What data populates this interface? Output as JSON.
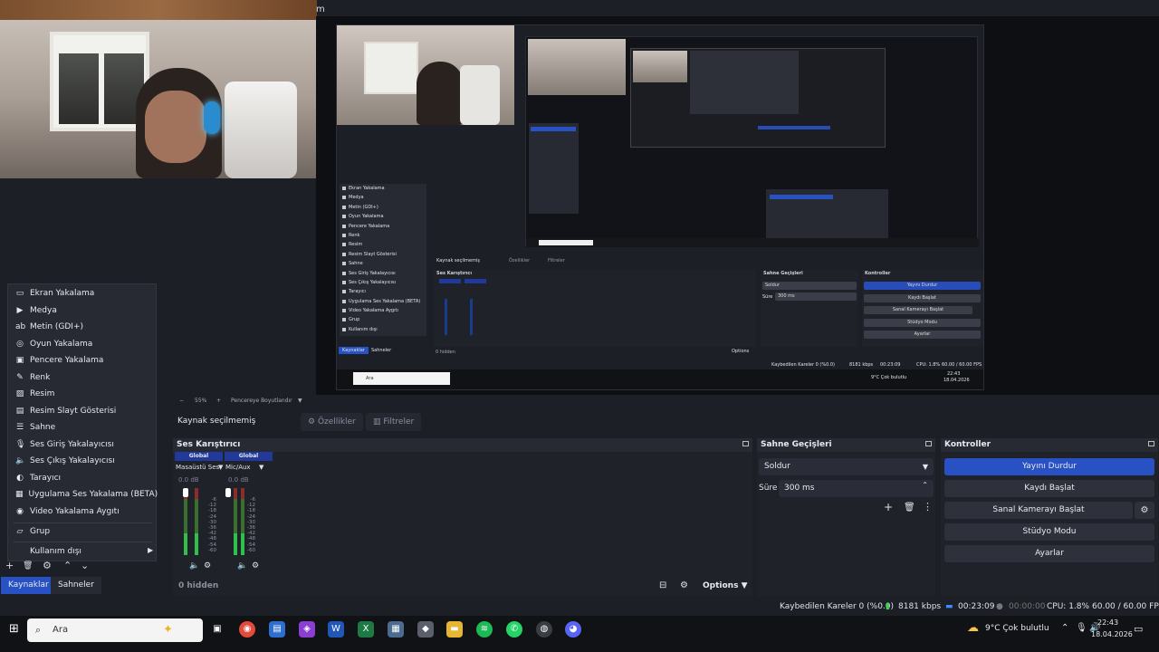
{
  "window": {
    "title_fragment": "m"
  },
  "context_menu": {
    "items": [
      {
        "label": "Ekran Yakalama",
        "icon": "monitor-icon"
      },
      {
        "label": "Medya",
        "icon": "play-icon"
      },
      {
        "label": "Metin (GDI+)",
        "icon": "text-icon"
      },
      {
        "label": "Oyun Yakalama",
        "icon": "gamepad-icon"
      },
      {
        "label": "Pencere Yakalama",
        "icon": "window-icon"
      },
      {
        "label": "Renk",
        "icon": "brush-icon"
      },
      {
        "label": "Resim",
        "icon": "image-icon"
      },
      {
        "label": "Resim Slayt Gösterisi",
        "icon": "slideshow-icon"
      },
      {
        "label": "Sahne",
        "icon": "list-icon"
      },
      {
        "label": "Ses Giriş Yakalayıcısı",
        "icon": "microphone-icon"
      },
      {
        "label": "Ses Çıkış Yakalayıcısı",
        "icon": "speaker-icon"
      },
      {
        "label": "Tarayıcı",
        "icon": "globe-icon"
      },
      {
        "label": "Uygulama Ses Yakalama (BETA)",
        "icon": "app-audio-icon"
      },
      {
        "label": "Video Yakalama Aygıtı",
        "icon": "camera-icon"
      },
      {
        "label": "Grup",
        "icon": "folder-icon"
      },
      {
        "label": "Kullanım dışı",
        "icon": "chevron-right-icon"
      }
    ]
  },
  "sources_toolbar": {
    "add": "+",
    "remove": "🗑",
    "settings": "⚙",
    "up": "⌃",
    "down": "⌄"
  },
  "bottom_tabs": {
    "sources": "Kaynaklar",
    "scenes": "Sahneler"
  },
  "preview": {
    "zoom": "55%",
    "fit_label": "Pencereye Boyutlandır"
  },
  "context_bar": {
    "no_source": "Kaynak seçilmemiş",
    "properties": "Özellikler",
    "filters": "Filtreler"
  },
  "mixer": {
    "title": "Ses Karıştırıcı",
    "channels": [
      {
        "group": "Global",
        "name": "Masaüstü Ses",
        "db": "0.0 dB"
      },
      {
        "group": "Global",
        "name": "Mic/Aux",
        "db": "0.0 dB"
      }
    ],
    "scale": [
      "-6",
      "-12",
      "-18",
      "-24",
      "-30",
      "-36",
      "-42",
      "-48",
      "-54",
      "-60"
    ],
    "hidden": "0 hidden",
    "options": "Options"
  },
  "scene_transitions": {
    "title": "Sahne Geçişleri",
    "transition": "Soldur",
    "duration_label": "Süre",
    "duration_value": "300 ms"
  },
  "controls": {
    "title": "Kontroller",
    "stop_stream": "Yayını Durdur",
    "start_record": "Kaydı Başlat",
    "start_virtual_cam": "Sanal Kamerayı Başlat",
    "studio_mode": "Stüdyo Modu",
    "settings": "Ayarlar"
  },
  "status_bar": {
    "dropped_frames": "Kaybedilen Kareler 0 (%0.0)",
    "bitrate": "8181 kbps",
    "stream_time": "00:23:09",
    "record_time": "00:00:00",
    "cpu": "CPU: 1.8%",
    "fps": "60.00 / 60.00 FPS"
  },
  "taskbar": {
    "search_placeholder": "Ara",
    "weather": "9°C  Çok bulutlu",
    "time": "22:43",
    "date": "18.04.2026"
  },
  "nested": {
    "menu_items": [
      "Ekran Yakalama",
      "Medya",
      "Metin (GDI+)",
      "Oyun Yakalama",
      "Pencere Yakalama",
      "Renk",
      "Resim",
      "Resim Slayt Gösterisi",
      "Sahne",
      "Ses Giriş Yakalayıcısı",
      "Ses Çıkış Yakalayıcısı",
      "Tarayıcı",
      "Uygulama Ses Yakalama (BETA)",
      "Video Yakalama Aygıtı",
      "Grup"
    ],
    "no_source": "Kaynak seçilmemiş",
    "properties": "Özellikler",
    "filters": "Filtreler",
    "mixer_title": "Ses Karıştırıcı",
    "scene_title": "Sahne Geçişleri",
    "controls_title": "Kontroller",
    "stop_stream": "Yayını Durdur",
    "start_record": "Kaydı Başlat",
    "virtual_cam": "Sanal Kamerayı Başlat",
    "studio_mode": "Stüdyo Modu",
    "settings": "Ayarlar",
    "transition": "Soldur",
    "duration_label": "Süre",
    "duration_value": "300 ms",
    "hidden": "0 hidden",
    "options": "Options",
    "sources_tab": "Kaynaklar",
    "scenes_tab": "Sahneler",
    "deprecated": "Kullanım dışı",
    "dropped": "Kaybedilen Kareler 0 (%0.0)",
    "bitrate": "8181 kbps",
    "stream_time": "00:23:09",
    "cpu": "CPU: 1.8%",
    "fps": "60.00 / 60.00 FPS",
    "search": "Ara",
    "weather": "9°C  Çok bulutlu",
    "time": "22:43",
    "date": "18.04.2026"
  }
}
